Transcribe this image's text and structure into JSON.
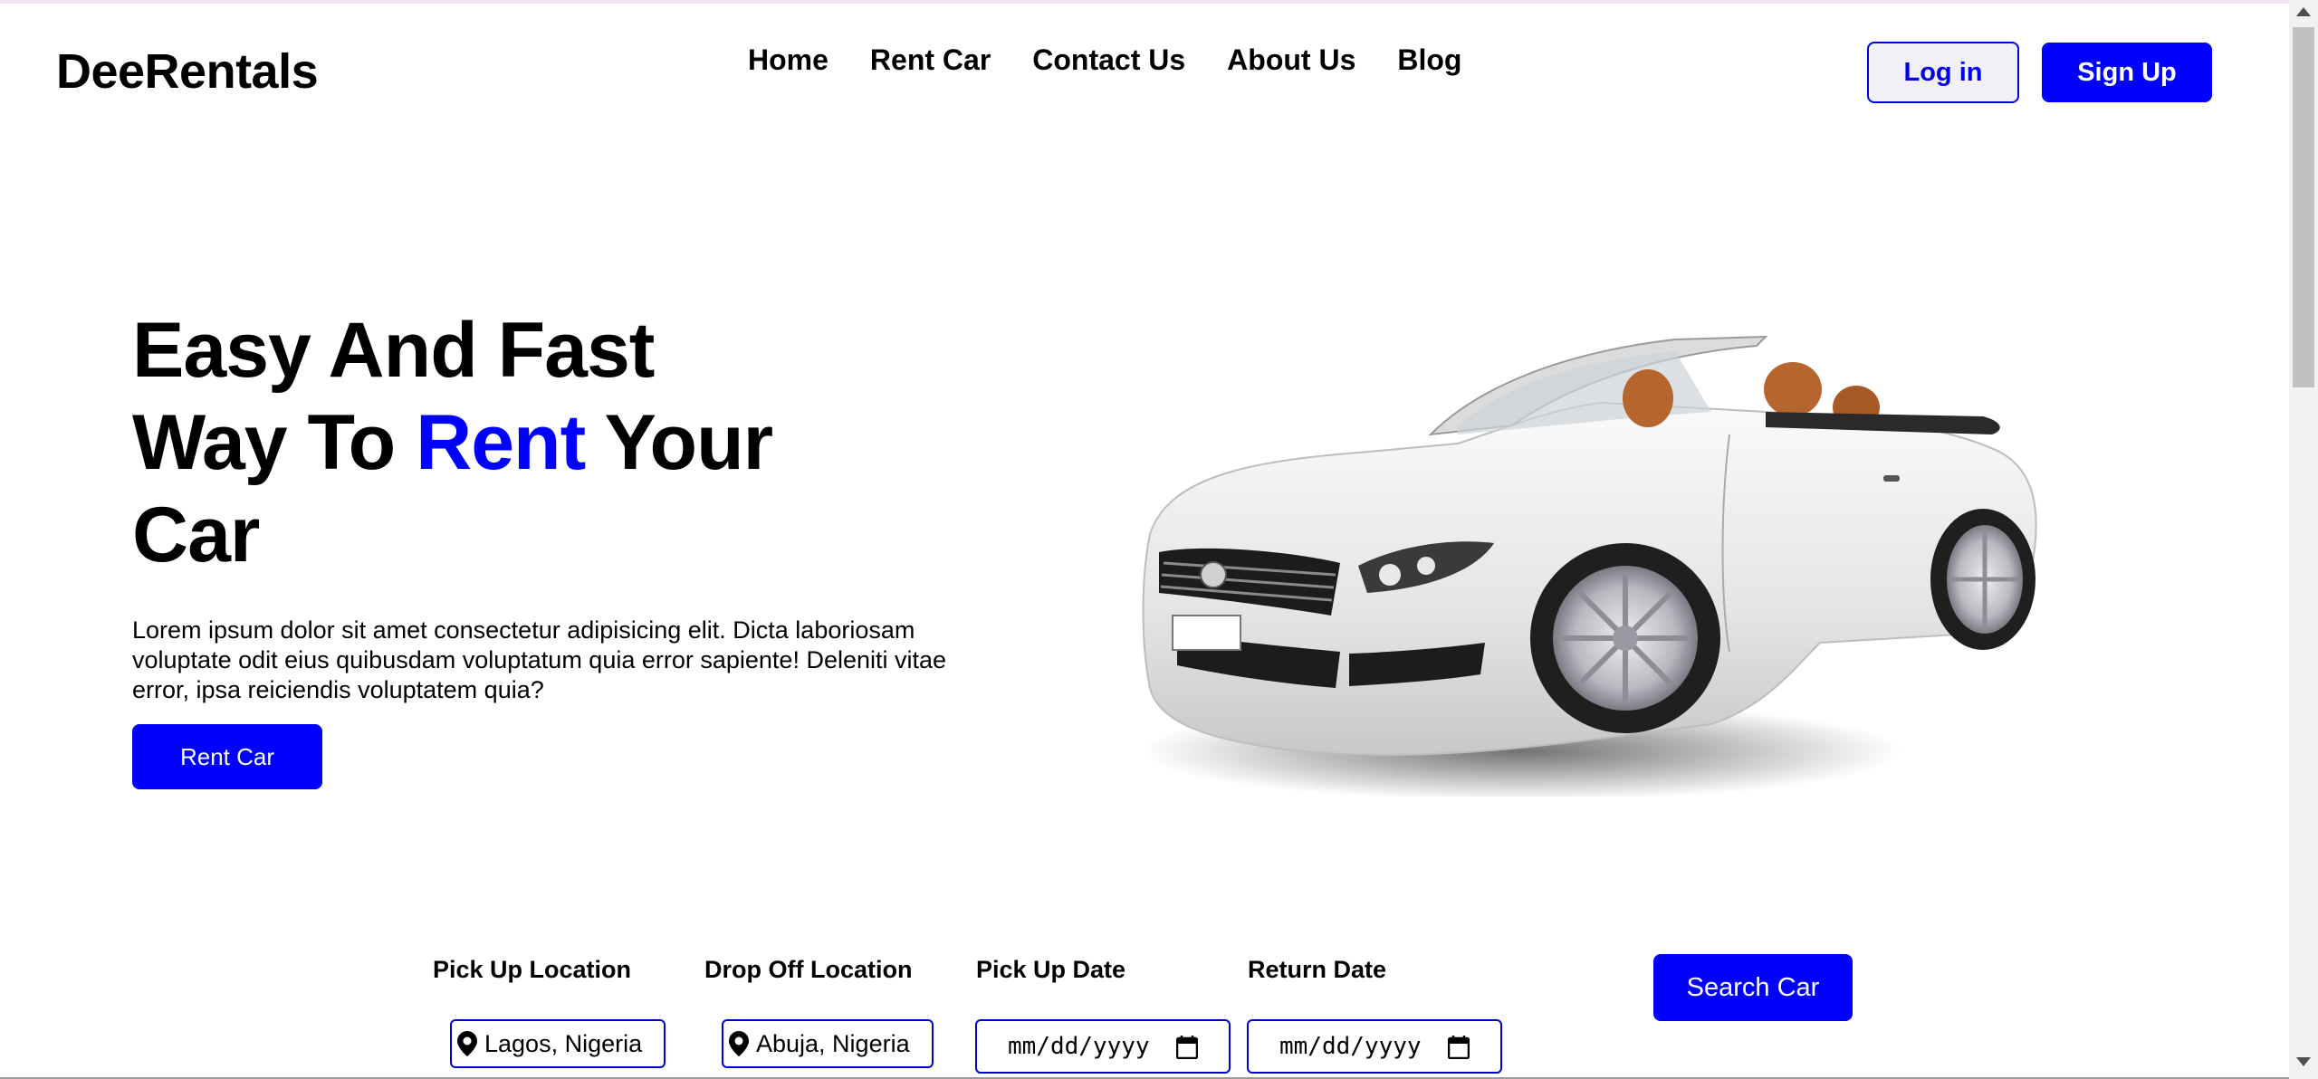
{
  "brand": {
    "name": "DeeRentals",
    "accent_color": "#0000ff"
  },
  "nav": {
    "items": [
      {
        "label": "Home"
      },
      {
        "label": "Rent Car"
      },
      {
        "label": "Contact Us"
      },
      {
        "label": "About Us"
      },
      {
        "label": "Blog"
      }
    ]
  },
  "auth": {
    "login_label": "Log in",
    "signup_label": "Sign Up"
  },
  "hero": {
    "title_line1": "Easy And Fast",
    "title_line2_before": "Way To ",
    "title_line2_accent": "Rent",
    "title_line2_after": " Your",
    "title_line3": "Car",
    "description": "Lorem ipsum dolor sit amet consectetur adipisicing elit. Dicta laboriosam voluptate odit eius quibusdam voluptatum quia error sapiente! Deleniti vitae error, ipsa reiciendis voluptatem quia?",
    "cta_label": "Rent Car",
    "image_icon": "white-convertible-car-image"
  },
  "search": {
    "pickup_location": {
      "label": "Pick Up Location",
      "value": "Lagos, Nigeria",
      "icon": "map-pin-icon"
    },
    "dropoff_location": {
      "label": "Drop Off Location",
      "value": "Abuja, Nigeria",
      "icon": "map-pin-icon"
    },
    "pickup_date": {
      "label": "Pick Up Date",
      "placeholder": "mm/dd/yyyy",
      "icon": "calendar-icon"
    },
    "return_date": {
      "label": "Return Date",
      "placeholder": "mm/dd/yyyy",
      "icon": "calendar-icon"
    },
    "submit_label": "Search Car"
  }
}
